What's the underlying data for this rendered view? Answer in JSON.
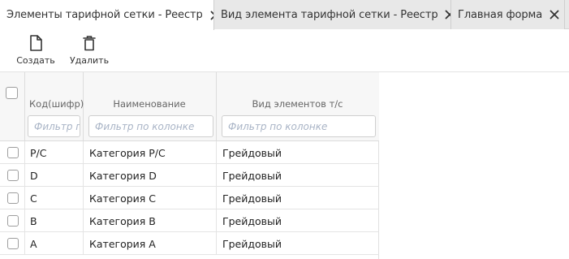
{
  "tabs": [
    {
      "label": "Элементы тарифной сетки - Реестр",
      "active": true
    },
    {
      "label": "Вид элемента тарифной сетки - Реестр",
      "active": false
    },
    {
      "label": "Главная форма",
      "active": false
    }
  ],
  "toolbar": {
    "create_label": "Создать",
    "delete_label": "Удалить",
    "create_icon": "document-icon",
    "delete_icon": "trash-icon"
  },
  "grid": {
    "columns": [
      {
        "header": "Код(шифр)",
        "filter_placeholder": "Фильтр по колонке"
      },
      {
        "header": "Наименование",
        "filter_placeholder": "Фильтр по колонке"
      },
      {
        "header": "Вид элементов т/с",
        "filter_placeholder": "Фильтр по колонке"
      }
    ],
    "rows": [
      {
        "code": "P/C",
        "name": "Категория P/C",
        "kind": "Грейдовый"
      },
      {
        "code": "D",
        "name": "Категория D",
        "kind": "Грейдовый"
      },
      {
        "code": "C",
        "name": "Категория C",
        "kind": "Грейдовый"
      },
      {
        "code": "B",
        "name": "Категория B",
        "kind": "Грейдовый"
      },
      {
        "code": "A",
        "name": "Категория A",
        "kind": "Грейдовый"
      }
    ]
  },
  "colors": {
    "tabbar_bg": "#e8e8e8",
    "placeholder": "#a9b4c6",
    "border": "#dcdcdc"
  }
}
